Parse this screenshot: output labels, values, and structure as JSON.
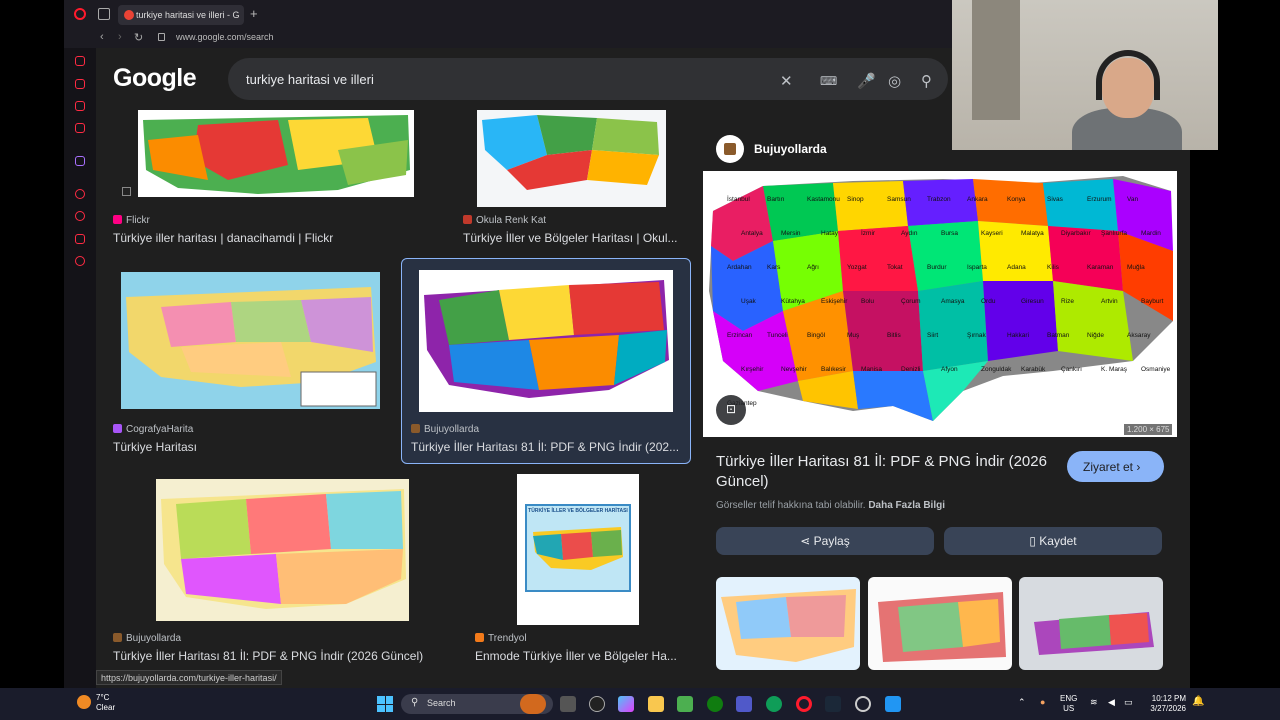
{
  "browser": {
    "tab_title": "turkiye haritasi ve illeri - G",
    "url": "www.google.com/search"
  },
  "search": {
    "logo": "Google",
    "query": "turkiye haritasi ve illeri"
  },
  "results": [
    {
      "source": "Flickr",
      "title": "Türkiye iller haritası | danacihamdi | Flickr",
      "fav_color": "#ff0084"
    },
    {
      "source": "Okula Renk Kat",
      "title": "Türkiye İller ve Bölgeler Haritası | Okul...",
      "fav_color": "#c0392b"
    },
    {
      "source": "CografyaHarita",
      "title": "Türkiye Haritası",
      "fav_color": "#a855f7"
    },
    {
      "source": "Bujuyollarda",
      "title": "Türkiye İller Haritası 81 İl: PDF & PNG İndir (202...",
      "fav_color": "#8a5a2b"
    },
    {
      "source": "Bujuyollarda",
      "title": "Türkiye İller Haritası 81 İl: PDF & PNG İndir (2026 Güncel)",
      "fav_color": "#8a5a2b"
    },
    {
      "source": "Trendyol",
      "title": "Enmode Türkiye İller ve Bölgeler Ha...",
      "fav_color": "#f27a1a"
    }
  ],
  "thumb_captions": {
    "poster": "TÜRKİYE İLLER VE BÖLGELER HARİTASI"
  },
  "preview": {
    "source": "Bujuyollarda",
    "title": "Türkiye İller Haritası 81 İl: PDF & PNG İndir (2026 Güncel)",
    "visit_label": "Ziyaret et",
    "copyright_note": "Görseller telif hakkına tabi olabilir.",
    "more_info": "Daha Fazla Bilgi",
    "share_label": "Paylaş",
    "save_label": "Kaydet",
    "dimensions": "1.200 × 675",
    "map_labels": [
      "İstanbul",
      "Bartın",
      "Kastamonu",
      "Sinop",
      "Samsun",
      "Trabzon",
      "Ankara",
      "Konya",
      "Sivas",
      "Erzurum",
      "Van",
      "Antalya",
      "Mersin",
      "Hatay",
      "İzmir",
      "Aydın",
      "Bursa",
      "Kayseri",
      "Malatya",
      "Diyarbakır",
      "Şanlıurfa",
      "Mardin",
      "Ardahan",
      "Kars",
      "Ağrı",
      "Yozgat",
      "Tokat",
      "Burdur",
      "Isparta",
      "Adana",
      "Kilis",
      "Karaman",
      "Muğla",
      "Uşak",
      "Kütahya",
      "Eskişehir",
      "Bolu",
      "Çorum",
      "Amasya",
      "Ordu",
      "Giresun",
      "Rize",
      "Artvin",
      "Bayburt",
      "Erzincan",
      "Tunceli",
      "Bingöl",
      "Muş",
      "Bitlis",
      "Siirt",
      "Şırnak",
      "Hakkari",
      "Batman",
      "Niğde",
      "Aksaray",
      "Kırşehir",
      "Nevşehir",
      "Balıkesir",
      "Manisa",
      "Denizli",
      "Afyon",
      "Zonguldak",
      "Karabük",
      "Çankırı",
      "K. Maraş",
      "Osmaniye",
      "Gaziantep"
    ]
  },
  "status_url": "https://bujuyollarda.com/turkiye-iller-haritasi/",
  "taskbar": {
    "temp": "7°C",
    "weather": "Clear",
    "search_label": "Search",
    "lang_top": "ENG",
    "lang_bottom": "US",
    "time": "10:12 PM",
    "date": "3/27/2026"
  }
}
